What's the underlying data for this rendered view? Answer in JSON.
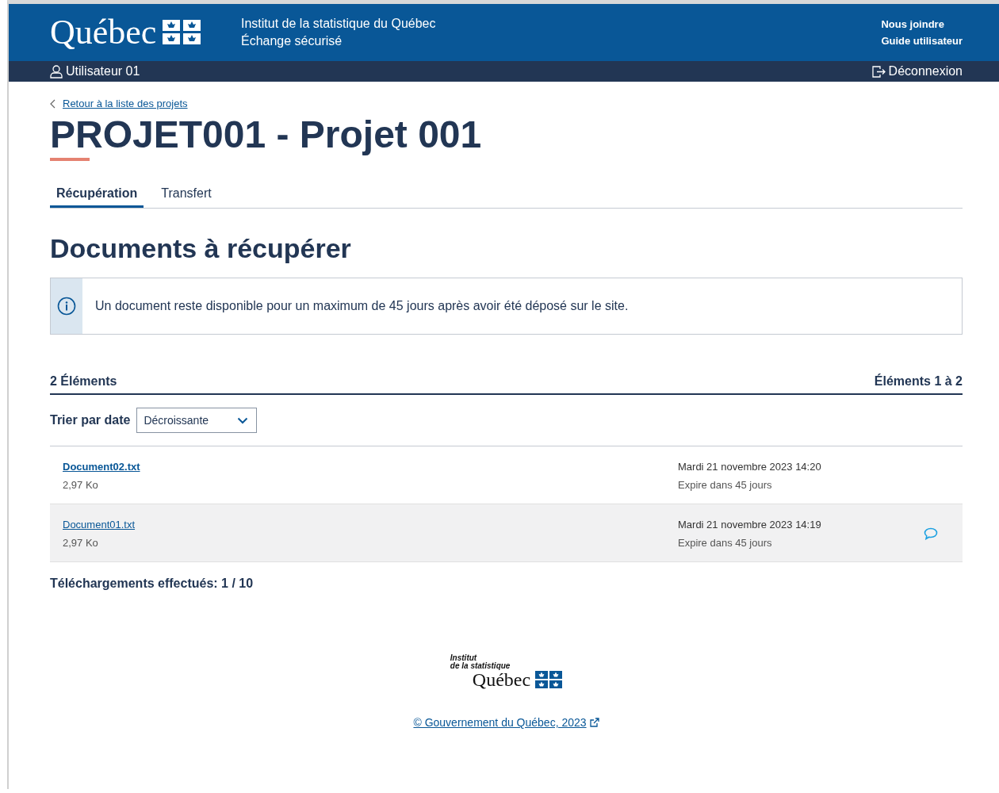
{
  "header": {
    "logo_text": "Québec",
    "org": "Institut de la statistique du Québec",
    "app": "Échange sécurisé",
    "links": [
      "Nous joindre",
      "Guide utilisateur"
    ]
  },
  "user_bar": {
    "user": "Utilisateur 01",
    "logout": "Déconnexion"
  },
  "back_link": "Retour à la liste des projets",
  "title": "PROJET001 - Projet 001",
  "tabs": [
    {
      "label": "Récupération",
      "selected": true
    },
    {
      "label": "Transfert",
      "selected": false
    }
  ],
  "section_title": "Documents à récupérer",
  "info": "Un document reste disponible pour un maximum de 45 jours après avoir été déposé sur le site.",
  "list": {
    "count": "2 Éléments",
    "range": "Éléments 1 à 2",
    "sort_label": "Trier par date",
    "sort_value": "Décroissante",
    "rows": [
      {
        "name": "Document02.txt",
        "size": "2,97 Ko",
        "date": "Mardi 21 novembre 2023 14:20",
        "expiry": "Expire dans 45 jours",
        "unread": true,
        "highlighted": false,
        "comment": false
      },
      {
        "name": "Document01.txt",
        "size": "2,97 Ko",
        "date": "Mardi 21 novembre 2023 14:19",
        "expiry": "Expire dans 45 jours",
        "unread": false,
        "highlighted": true,
        "comment": true
      }
    ]
  },
  "downloads": "Téléchargements effectués: 1 / 10",
  "footer": {
    "logo_line1": "Institut",
    "logo_line2": "de la statistique",
    "logo_text": "Québec",
    "copyright": "© Gouvernement du Québec, 2023"
  }
}
